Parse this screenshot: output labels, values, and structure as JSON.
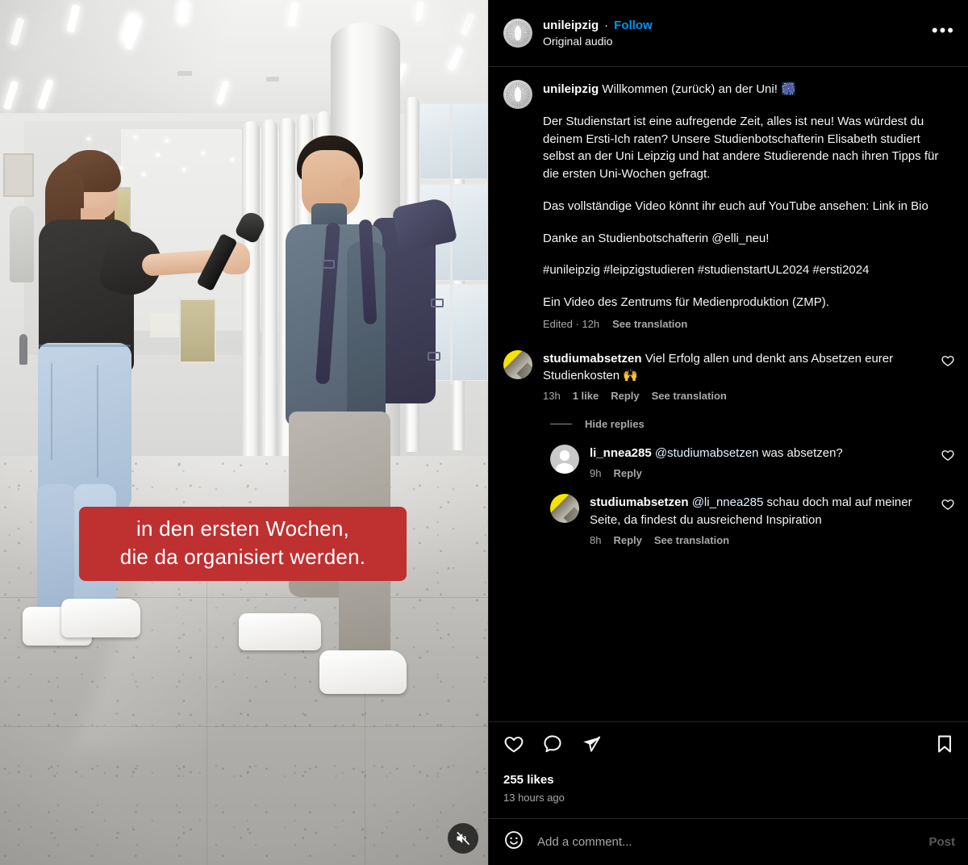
{
  "post": {
    "header": {
      "username": "unileipzig",
      "separator": "·",
      "follow_label": "Follow",
      "audio_label": "Original audio",
      "more_label": "•••",
      "avatar_icon": "university-seal-avatar"
    },
    "caption": {
      "username": "unileipzig",
      "first_line": "Willkommen (zurück) an der Uni!",
      "first_line_emoji": "🎆",
      "paragraphs": [
        "Der Studienstart ist eine aufregende Zeit, alles ist neu! Was würdest du deinem Ersti-Ich raten? Unsere Studienbotschafterin Elisabeth studiert selbst an der Uni Leipzig und hat andere Studierende nach ihren Tipps für die ersten Uni-Wochen gefragt.",
        "Das vollständige Video könnt ihr euch auf YouTube ansehen: Link in Bio",
        "Danke an Studienbotschafterin @elli_neu!",
        "#unileipzig #leipzigstudieren #studienstartUL2024 #ersti2024",
        "Ein Video des Zentrums für Medienproduktion (ZMP)."
      ],
      "edited_label": "Edited · 12h",
      "see_translation_label": "See translation"
    },
    "comments": [
      {
        "username": "studiumabsetzen",
        "text": "Viel Erfolg allen und denkt ans Absetzen eurer Studienkosten 🙌",
        "time": "13h",
        "likes": "1 like",
        "reply_label": "Reply",
        "see_translation_label": "See translation",
        "avatar_icon": "yellow-stripe-avatar",
        "like_icon": "heart-outline-icon"
      },
      {
        "username": "li_nnea285",
        "mention": "@studiumabsetzen",
        "text": "was absetzen?",
        "time": "9h",
        "reply_label": "Reply",
        "avatar_icon": "default-person-avatar",
        "like_icon": "heart-outline-icon",
        "is_reply": true
      },
      {
        "username": "studiumabsetzen",
        "mention": "@li_nnea285",
        "text": "schau doch mal auf meiner Seite, da findest du ausreichend Inspiration",
        "time": "8h",
        "reply_label": "Reply",
        "see_translation_label": "See translation",
        "avatar_icon": "yellow-stripe-avatar",
        "like_icon": "heart-outline-icon",
        "is_reply": true
      }
    ],
    "hide_replies_label": "Hide replies",
    "actions": {
      "like_icon": "heart-outline-icon",
      "comment_icon": "speech-bubble-icon",
      "share_icon": "paper-plane-icon",
      "save_icon": "bookmark-outline-icon"
    },
    "likes_count": "255 likes",
    "timestamp": "13 hours ago",
    "add_comment": {
      "emoji_icon": "smiley-face-icon",
      "placeholder": "Add a comment...",
      "value": "",
      "post_label": "Post"
    }
  },
  "video": {
    "subtitle_line1": "in den ersten Wochen,",
    "subtitle_line2": "die da organisiert werden.",
    "subtitle_bg_color": "#bf3030",
    "mute_icon": "speaker-muted-icon",
    "scene_description": "Interviewerin mit Mikrofon und Student mit Rucksack in einer hellen Universitätshalle"
  },
  "colors": {
    "background": "#000000",
    "text_primary": "#f5f5f5",
    "text_muted": "#a8a8a8",
    "link_blue": "#0095f6",
    "divider": "#262626",
    "subtitle_red": "#bf3030"
  }
}
